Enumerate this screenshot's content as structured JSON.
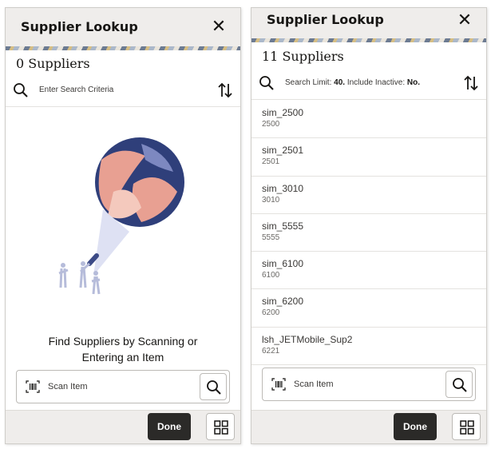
{
  "left_panel": {
    "title": "Supplier Lookup",
    "close_symbol": "✕",
    "count_label": "0 Suppliers",
    "search_placeholder": "Enter Search Criteria",
    "empty_message_line1": "Find Suppliers by Scanning or",
    "empty_message_line2": "Entering an Item",
    "scan_label": "Scan Item",
    "done_label": "Done"
  },
  "right_panel": {
    "title": "Supplier Lookup",
    "close_symbol": "✕",
    "count_label": "11 Suppliers",
    "search_limit_prefix": "Search Limit:",
    "search_limit_value": "40.",
    "include_inactive_prefix": "Include Inactive:",
    "include_inactive_value": "No.",
    "suppliers": [
      {
        "name": "sim_2500",
        "code": "2500"
      },
      {
        "name": "sim_2501",
        "code": "2501"
      },
      {
        "name": "sim_3010",
        "code": "3010"
      },
      {
        "name": "sim_5555",
        "code": "5555"
      },
      {
        "name": "sim_6100",
        "code": "6100"
      },
      {
        "name": "sim_6200",
        "code": "6200"
      },
      {
        "name": "lsh_JETMobile_Sup2",
        "code": "6221"
      }
    ],
    "scan_label": "Scan Item",
    "done_label": "Done"
  },
  "icons": [
    "search-icon",
    "sort-icon",
    "close-icon",
    "barcode-icon",
    "grid-icon",
    "search-illustration"
  ],
  "colors": {
    "primary_button": "#2b2a28",
    "header_bg": "#efedeb",
    "text": "#161513"
  }
}
